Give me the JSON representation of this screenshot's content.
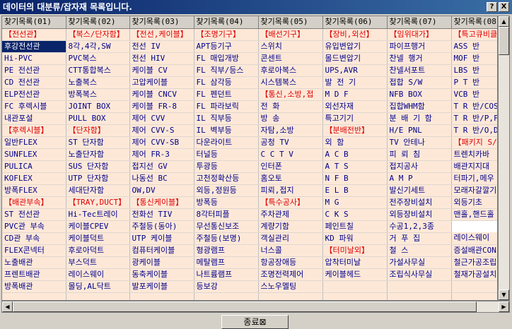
{
  "window": {
    "title": "데이터의 대분류/잡자재 목록입니다.",
    "help_btn": "?",
    "close_btn": "X"
  },
  "grid": {
    "columns": [
      "찾기목록(01)",
      "찾기목록(02)",
      "찾기목록(03)",
      "찾기목록(04)",
      "찾기목록(05)",
      "찾기목록(06)",
      "찾기목록(07)",
      "찾기목록(08)"
    ],
    "rows": [
      [
        "【전선관】",
        "【복스/단자함】",
        "【전선,케이블】",
        "【조명기구】",
        "【배선기구】",
        "【장비,외선】",
        "【임위대가】",
        "【특고큐비클"
      ],
      [
        "후강전선관",
        "8각,4각,SW",
        "전선 IV",
        "APT등기구",
        "스위치",
        "유입변압기",
        "파이프행거",
        "ASS 반"
      ],
      [
        "Hi-PVC",
        "PVC복스",
        "전선 HIV",
        "FL 매입개방",
        "콘센트",
        "몰드변압기",
        "찬넬 행거",
        "MOF 반"
      ],
      [
        "PE 전선관",
        "CTT통합복스",
        "케이블 CV",
        "FL 직부/등스",
        "후로아복스",
        "UPS,AVR",
        "찬넬서포트",
        "LBS 반"
      ],
      [
        "CD 전선관",
        "노출복스",
        "고압케이블",
        "FL 삼각등",
        "시스템복스",
        "발 전 기",
        "접합 S/W",
        "P T 반"
      ],
      [
        "ELP전선관",
        "방폭복스",
        "케이블 CNCV",
        "FL 펜던트",
        "【통신,소방,접",
        "M D F",
        "NFB BOX",
        "VCB 반"
      ],
      [
        "FC 후렉시블",
        "JOINT BOX",
        "케이블 FR-8",
        "FL 파라보릭",
        "전 화",
        "외선자재",
        "집합WHM함",
        "T R 반/COS"
      ],
      [
        "내관포설",
        "PULL BOX",
        "제어 CVV",
        "IL 직부등",
        "방 송",
        "특고기기",
        "분 배 기 함",
        "T R 반/P,F"
      ],
      [
        "【후렉시블】",
        "【단자함】",
        "제어 CVV-S",
        "IL 벽부등",
        "자탐,소방",
        "【분배전반】",
        "H/E PNL",
        "T R 반/O,D"
      ],
      [
        "일반FLEX",
        "ST 단자함",
        "제어 CVV-SB",
        "다운라이트",
        "공청 TV",
        "외 함",
        "TV 안테나",
        "【패키지 S/"
      ],
      [
        "SUNFLEX",
        "노출단자함",
        "제어 FR-3",
        "터널등",
        "C C T V",
        "A C B",
        "피 뢰 침",
        "트렌치카바"
      ],
      [
        "PULICA",
        "SUS 단자함",
        "접지선 GV",
        "투광등",
        "인터폰",
        "A T S",
        "접지공사",
        "배관지지대"
      ],
      [
        "KOFLEX",
        "UTP 단자함",
        "나동선 BC",
        "고천정확산등",
        "홈오토",
        "N F B",
        "A M P",
        "터파기,메우"
      ],
      [
        "방폭FLEX",
        "세대단자함",
        "OW,DV",
        "외등,정원등",
        "피뢰,접지",
        "E L B",
        "발신기세트",
        "모래자갈깔기"
      ],
      [
        "【배관부속】",
        "【TRAY,DUCT】",
        "【통신케이블】",
        "방폭등",
        "【특수공사】",
        "M G",
        "전주장비설치",
        "외등기초"
      ],
      [
        "ST 전선관",
        "Hi-Tec트레이",
        "전화선 TIV",
        "8각터피플",
        "주차관제",
        "C K S",
        "외등장비설치",
        "맨홀,핸드홀"
      ],
      [
        "PVC관 부속",
        "케이블CPEV",
        "주철등(동아)",
        "무선통신보조",
        "계량기함",
        "페인트칠",
        "수공1,2,3종"
      ],
      [
        "CD관 부속",
        "케이블덕트",
        "UTP 케이블",
        "주철등(보명)",
        "객실관리",
        "KD 파워",
        "거 푸 집",
        "레이스웨이"
      ],
      [
        "FLEX콘넥터",
        "후로아덕트",
        "컴퓨터케이블",
        "형광램프",
        "너스콜",
        "【터미날외】",
        "철 스",
        "증설배관CON"
      ],
      [
        "노출배관",
        "부스덕트",
        "광케이블",
        "메탈램프",
        "항공장애등",
        "압착터미날",
        "가설사무실",
        "철근가공조립"
      ],
      [
        "프렌트배관",
        "레이스웨이",
        "동축케이블",
        "나트륨램프",
        "조명전력제어",
        "케이블헤드",
        "조립식사무실",
        "철재가공설치"
      ],
      [
        "방폭배관",
        "몰딩,AL닥트",
        "발포케이블",
        "등보강",
        "스노우멜팅",
        "",
        "",
        ""
      ],
      [
        "",
        "",
        "",
        "",
        "",
        "",
        "",
        ""
      ],
      [
        "",
        "",
        "",
        "",
        "",
        "",
        "",
        ""
      ]
    ],
    "category_cells": [
      "0-0",
      "0-1",
      "0-2",
      "0-3",
      "0-4",
      "0-5",
      "0-6",
      "0-7",
      "5-4",
      "8-0",
      "8-1",
      "8-5",
      "9-7",
      "14-0",
      "14-1",
      "14-2",
      "14-4",
      "18-5"
    ],
    "selected_cell": "1-0"
  },
  "footer": {
    "close_label": "종료⊠"
  },
  "colors": {
    "cell_bg": "#fde8d8",
    "category_text": "#e00000",
    "item_text": "#00008b",
    "selection_bg": "#0a246a"
  }
}
